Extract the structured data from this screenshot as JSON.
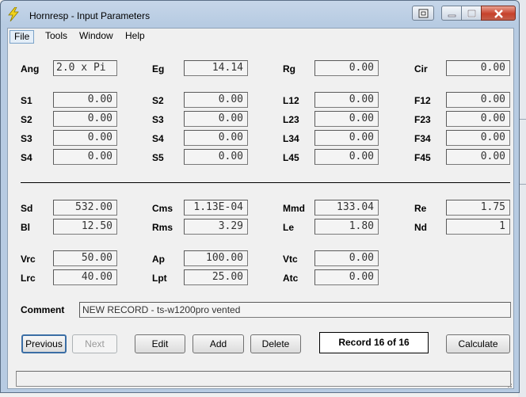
{
  "window": {
    "title": "Hornresp - Input Parameters"
  },
  "menu": [
    {
      "label": "File"
    },
    {
      "label": "Tools"
    },
    {
      "label": "Window"
    },
    {
      "label": "Help"
    }
  ],
  "params": {
    "Ang": "2.0 x Pi",
    "Eg": "14.14",
    "Rg": "0.00",
    "Cir": "0.00",
    "S1": "0.00",
    "S2_a": "0.00",
    "L12": "0.00",
    "F12": "0.00",
    "S2_b": "0.00",
    "S3_a": "0.00",
    "L23": "0.00",
    "F23": "0.00",
    "S3_b": "0.00",
    "S4_a": "0.00",
    "L34": "0.00",
    "F34": "0.00",
    "S4_b": "0.00",
    "S5": "0.00",
    "L45": "0.00",
    "F45": "0.00",
    "Sd": "532.00",
    "Cms": "1.13E-04",
    "Mmd": "133.04",
    "Re": "1.75",
    "Bl": "12.50",
    "Rms": "3.29",
    "Le": "1.80",
    "Nd": "1",
    "Vrc": "50.00",
    "Ap": "100.00",
    "Vtc": "0.00",
    "Lrc": "40.00",
    "Lpt": "25.00",
    "Atc": "0.00"
  },
  "labels": {
    "Ang": "Ang",
    "Eg": "Eg",
    "Rg": "Rg",
    "Cir": "Cir",
    "S1": "S1",
    "S2a": "S2",
    "L12": "L12",
    "F12": "F12",
    "S2b": "S2",
    "S3a": "S3",
    "L23": "L23",
    "F23": "F23",
    "S3b": "S3",
    "S4a": "S4",
    "L34": "L34",
    "F34": "F34",
    "S4b": "S4",
    "S5": "S5",
    "L45": "L45",
    "F45": "F45",
    "Sd": "Sd",
    "Cms": "Cms",
    "Mmd": "Mmd",
    "Re": "Re",
    "Bl": "Bl",
    "Rms": "Rms",
    "Le": "Le",
    "Nd": "Nd",
    "Vrc": "Vrc",
    "Ap": "Ap",
    "Vtc": "Vtc",
    "Lrc": "Lrc",
    "Lpt": "Lpt",
    "Atc": "Atc",
    "Comment": "Comment"
  },
  "comment": "NEW RECORD - ts-w1200pro vented",
  "buttons": {
    "previous": "Previous",
    "next": "Next",
    "edit": "Edit",
    "add": "Add",
    "delete": "Delete",
    "calculate": "Calculate"
  },
  "record_status": "Record 16 of 16",
  "icons": {
    "app": "lightning-bolt-icon",
    "system": "system-menu-icon",
    "minimize": "minimize-icon",
    "maximize": "maximize-icon",
    "close": "close-icon"
  }
}
